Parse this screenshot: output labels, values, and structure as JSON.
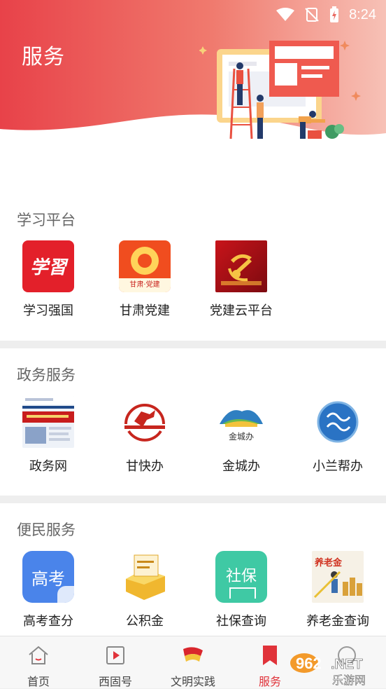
{
  "status_bar": {
    "time": "8:24"
  },
  "header": {
    "title": "服务"
  },
  "sections": [
    {
      "title": "学习平台",
      "items": [
        {
          "label": "学习强国",
          "icon": "xuexi-qiangguo-icon",
          "icon_text": "学習"
        },
        {
          "label": "甘肃党建",
          "icon": "gansu-dangjian-icon",
          "icon_text": "甘肃·党建"
        },
        {
          "label": "党建云平台",
          "icon": "dangjian-cloud-icon"
        }
      ]
    },
    {
      "title": "政务服务",
      "items": [
        {
          "label": "政务网",
          "icon": "zhengwu-web-icon"
        },
        {
          "label": "甘快办",
          "icon": "gan-kuaiban-icon"
        },
        {
          "label": "金城办",
          "icon": "jincheng-ban-icon",
          "icon_text": "金城办"
        },
        {
          "label": "小兰帮办",
          "icon": "xiaolan-bangban-icon"
        }
      ]
    },
    {
      "title": "便民服务",
      "items": [
        {
          "label": "高考查分",
          "icon": "gaokao-icon",
          "icon_text": "高考"
        },
        {
          "label": "公积金",
          "icon": "gongjijin-icon"
        },
        {
          "label": "社保查询",
          "icon": "shebao-icon",
          "icon_text": "社保"
        },
        {
          "label": "养老金查询",
          "icon": "yanglaojin-icon",
          "icon_text": "养老金"
        }
      ]
    }
  ],
  "tabbar": {
    "items": [
      {
        "label": "首页",
        "icon": "home-icon"
      },
      {
        "label": "西固号",
        "icon": "video-play-icon"
      },
      {
        "label": "文明实践",
        "icon": "flag-icon"
      },
      {
        "label": "服务",
        "icon": "bookmark-icon",
        "active": true
      }
    ]
  },
  "watermark": {
    "brand": "962.NET",
    "sub": "乐游网"
  },
  "colors": {
    "accent": "#e0333a",
    "header_top": "#e84249",
    "header_bottom": "#f3a8a0",
    "section_title": "#666666"
  }
}
